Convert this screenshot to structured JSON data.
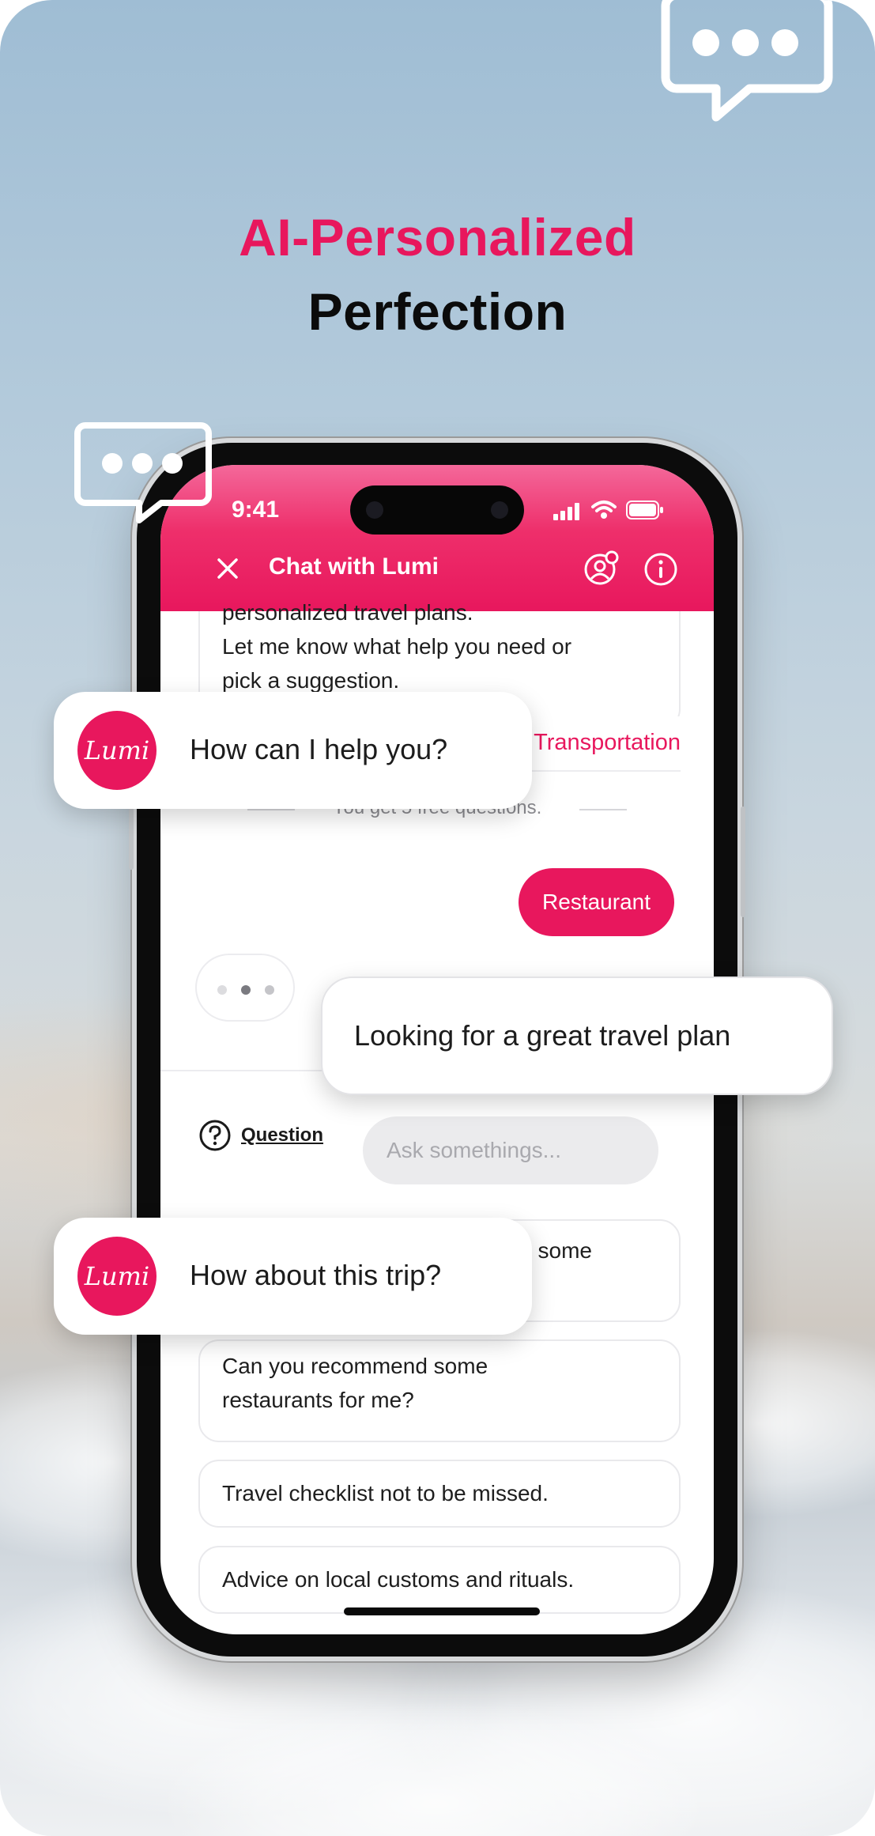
{
  "headline": {
    "line1": "AI-Personalized",
    "line2": "Perfection"
  },
  "colors": {
    "accent": "#e8175d",
    "white": "#ffffff"
  },
  "status_bar": {
    "time": "9:41"
  },
  "header": {
    "title": "Chat with Lumi",
    "close_icon": "close-icon",
    "avatar_settings_icon": "user-settings-icon",
    "info_icon": "info-icon"
  },
  "chat": {
    "intro_lines": [
      "personalized travel plans.",
      "Let me know what help you need or",
      "pick a suggestion."
    ],
    "suggestion_partial": "Transportation",
    "free_notice": "You get 5 free questions.",
    "user_message": "Restaurant",
    "typing_indicator": "typing"
  },
  "input": {
    "question_label": "Question",
    "placeholder": "Ask somethings..."
  },
  "suggestions": [
    {
      "text": "Can you recommend some"
    },
    {
      "text": "Can you recommend some restaurants for me?"
    },
    {
      "text": "Travel checklist not to be missed."
    },
    {
      "text": "Advice on local customs and rituals."
    }
  ],
  "floating": {
    "help": {
      "avatar": "Lumi",
      "text": "How can I help you?"
    },
    "plan": {
      "text": "Looking for a great travel plan"
    },
    "trip": {
      "avatar": "Lumi",
      "text": "How about this trip?"
    }
  }
}
